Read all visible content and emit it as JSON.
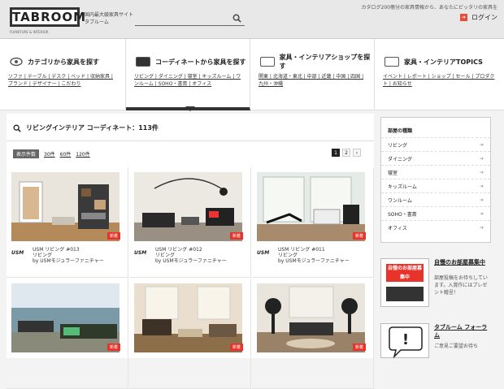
{
  "header": {
    "logo": "TABROOM",
    "logo_sub": "FURNITURE & INTERIOR",
    "site_desc": "国内最大級家具サイト タブルーム",
    "tagline": "カタログ200冊分の家具情報から、あなたにピッタリの家具を",
    "login_label": "ログイン",
    "search_placeholder": ""
  },
  "nav": {
    "tabs": [
      {
        "label": "カテゴリから家具を探す",
        "links": "ソファ | テーブル | デスク | ベッド | 収納家具 | ブランド | デザイナー | こだわり"
      },
      {
        "label": "コーディネートから家具を探す",
        "links": "リビング | ダイニング | 寝室 | キッズルーム | ワンルーム | SOHO・書斎 | オフィス"
      },
      {
        "label": "家具・インテリアショップを探す",
        "links": "関東 | 北海道・東北 | 中部 | 近畿 | 中国 | 四国 | 九州・沖縄"
      },
      {
        "label": "家具・インテリアTOPICS",
        "links": "イベント | レポート | ショップ | セール | プロダクト | お知らせ"
      }
    ]
  },
  "results": {
    "title": "リビングインテリア コーディネート：113件",
    "sort_label": "表示件数",
    "sort_options": [
      "30件",
      "60件",
      "120件"
    ],
    "pages": [
      "1",
      "2",
      "›"
    ]
  },
  "cards": [
    {
      "title": "USM リビング #013",
      "cat": "リビング",
      "by": "by USMモジュラーファニチャー",
      "badge": "新着",
      "brand": "USM"
    },
    {
      "title": "USM リビング #012",
      "cat": "リビング",
      "by": "by USMモジュラーファニチャー",
      "badge": "新着",
      "brand": "USM"
    },
    {
      "title": "USM リビング #011",
      "cat": "リビング",
      "by": "by USMモジュラーファニチャー",
      "badge": "新着",
      "brand": "USM"
    },
    {
      "title": "",
      "cat": "",
      "by": "",
      "badge": "新着",
      "brand": ""
    },
    {
      "title": "",
      "cat": "",
      "by": "",
      "badge": "新着",
      "brand": ""
    },
    {
      "title": "",
      "cat": "",
      "by": "",
      "badge": "新着",
      "brand": ""
    }
  ],
  "sidebar": {
    "title": "部屋の種類",
    "items": [
      "リビング",
      "ダイニング",
      "寝室",
      "キッズルーム",
      "ワンルーム",
      "SOHO・書斎",
      "オフィス"
    ]
  },
  "promos": [
    {
      "pic_text": "自慢のお部屋募集中",
      "title": "自慢のお部屋募集中",
      "text": "部屋投稿をお待ちしています。入賞作にはプレゼント贈呈！"
    },
    {
      "pic_text": "!",
      "title": "タブルーム フォーラム",
      "text": "ご意見ご要望お待ち"
    }
  ],
  "colors": {
    "accent": "#e8332a",
    "dark": "#333333"
  }
}
